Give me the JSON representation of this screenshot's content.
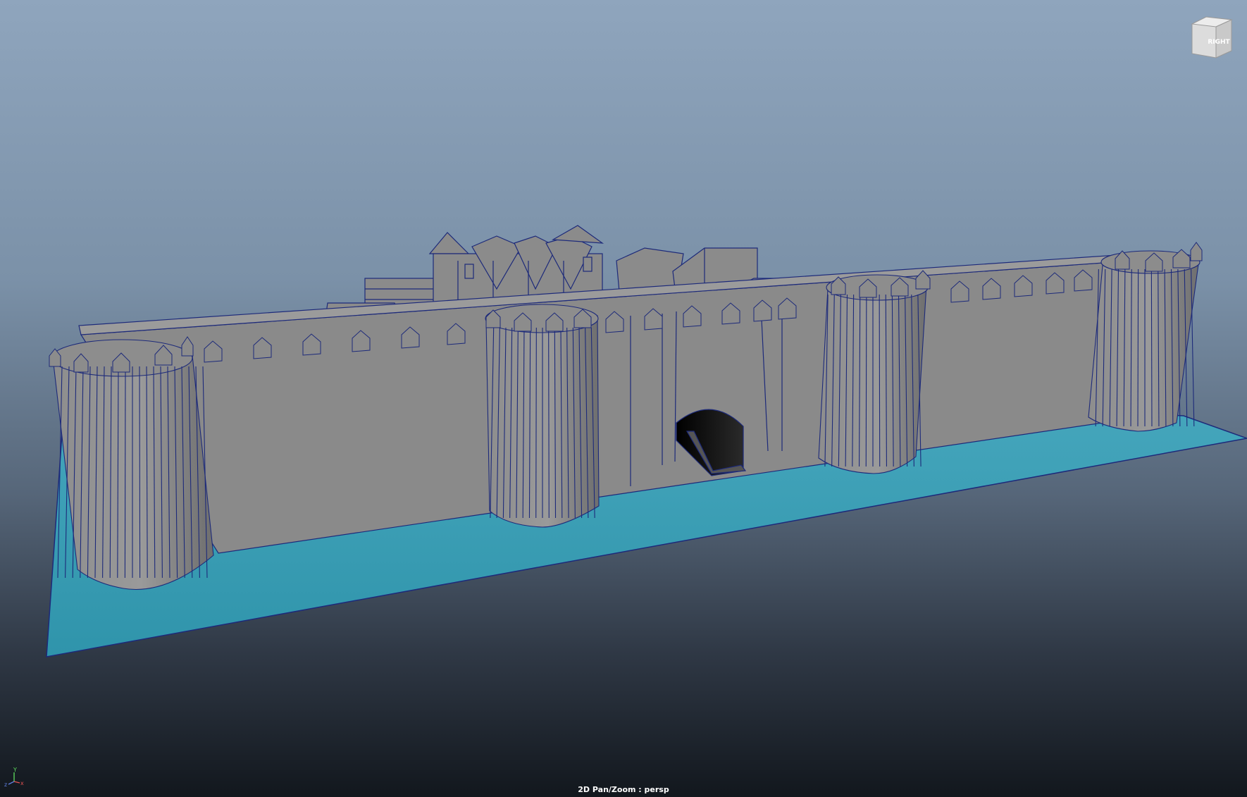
{
  "viewport": {
    "camera_label": "2D Pan/Zoom : persp",
    "background_top": "#8fa5bd",
    "background_bottom": "#12171d"
  },
  "view_cube": {
    "face_label": "RIGHT"
  },
  "axis_indicator": {
    "x_label": "x",
    "y_label": "Y",
    "z_label": "z"
  },
  "colors": {
    "water": "#3f9fb4",
    "wall": "#8a8a8a",
    "wireframe": "#1d2a7a"
  }
}
